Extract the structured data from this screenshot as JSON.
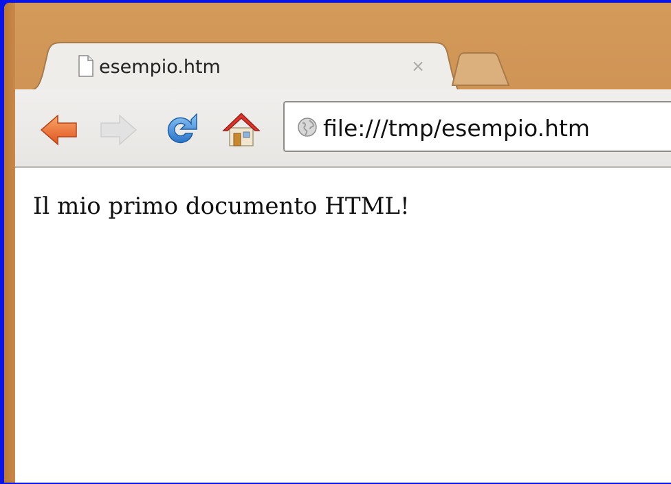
{
  "browser": {
    "tab": {
      "title": "esempio.htm",
      "close_symbol": "×",
      "icon": "page-icon"
    },
    "toolbar": {
      "back_icon": "back-arrow-icon",
      "forward_icon": "forward-arrow-icon",
      "reload_icon": "reload-icon",
      "home_icon": "home-icon"
    },
    "omnibox": {
      "url": "file:///tmp/esempio.htm",
      "icon": "globe-icon"
    }
  },
  "page": {
    "text": "Il mio primo documento HTML!"
  },
  "colors": {
    "desktop": "#0a14e6",
    "frame": "#d39a5a",
    "back_arrow": "#e8622a",
    "reload": "#3a8ad8",
    "home_roof": "#d8342c"
  }
}
